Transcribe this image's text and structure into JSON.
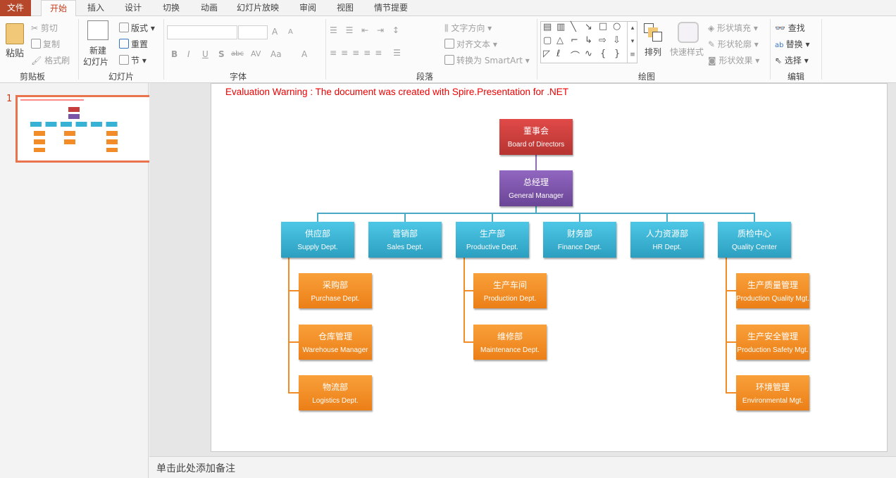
{
  "tabs": [
    "文件",
    "开始",
    "插入",
    "设计",
    "切换",
    "动画",
    "幻灯片放映",
    "审阅",
    "视图",
    "情节提要"
  ],
  "ribbon": {
    "clipboard": {
      "label": "剪贴板",
      "paste": "粘贴",
      "cut": "剪切",
      "copy": "复制",
      "format_painter": "格式刷"
    },
    "slides": {
      "label": "幻灯片",
      "new_slide_1": "新建",
      "new_slide_2": "幻灯片",
      "layout": "版式",
      "reset": "重置",
      "section": "节"
    },
    "font": {
      "label": "字体",
      "bold": "B",
      "italic": "I",
      "underline": "U",
      "shadow": "S",
      "strike": "abc",
      "spacing": "AV",
      "case": "Aa",
      "color": "A",
      "grow": "A",
      "shrink": "A"
    },
    "paragraph": {
      "label": "段落",
      "text_direction": "文字方向",
      "align_text": "对齐文本",
      "smartart": "转换为 SmartArt"
    },
    "drawing": {
      "label": "绘图",
      "arrange": "排列",
      "quick_styles": "快速样式",
      "fill": "形状填充",
      "outline": "形状轮廓",
      "effects": "形状效果"
    },
    "editing": {
      "label": "编辑",
      "find": "查找",
      "replace": "替换",
      "select": "选择"
    }
  },
  "thumbnail": {
    "number": "1"
  },
  "slide": {
    "warning": "Evaluation Warning : The document was created with  Spire.Presentation for .NET",
    "nodes": [
      {
        "cn": "董事会",
        "en": "Board of Directors",
        "color": "#c63d3b"
      },
      {
        "cn": "总经理",
        "en": "General Manager",
        "color": "#7b54a8"
      },
      {
        "cn": "供应部",
        "en": "Supply Dept.",
        "color": "#37b2d4"
      },
      {
        "cn": "营销部",
        "en": "Sales Dept.",
        "color": "#37b2d4"
      },
      {
        "cn": "生产部",
        "en": "Productive Dept.",
        "color": "#37b2d4"
      },
      {
        "cn": "财务部",
        "en": "Finance Dept.",
        "color": "#37b2d4"
      },
      {
        "cn": "人力资源部",
        "en": "HR Dept.",
        "color": "#37b2d4"
      },
      {
        "cn": "质检中心",
        "en": "Quality Center",
        "color": "#37b2d4"
      },
      {
        "cn": "采购部",
        "en": "Purchase Dept.",
        "color": "#f28c28"
      },
      {
        "cn": "仓库管理",
        "en": "Warehouse Manager",
        "color": "#f28c28"
      },
      {
        "cn": "物流部",
        "en": "Logistics Dept.",
        "color": "#f28c28"
      },
      {
        "cn": "生产车间",
        "en": "Production Dept.",
        "color": "#f28c28"
      },
      {
        "cn": "维修部",
        "en": "Maintenance Dept.",
        "color": "#f28c28"
      },
      {
        "cn": "生产质量管理",
        "en": "Production Quality Mgt.",
        "color": "#f28c28"
      },
      {
        "cn": "生产安全管理",
        "en": "Production Safety Mgt.",
        "color": "#f28c28"
      },
      {
        "cn": "环境管理",
        "en": "Environmental Mgt.",
        "color": "#f28c28"
      }
    ]
  },
  "notes": {
    "placeholder": "单击此处添加备注"
  }
}
